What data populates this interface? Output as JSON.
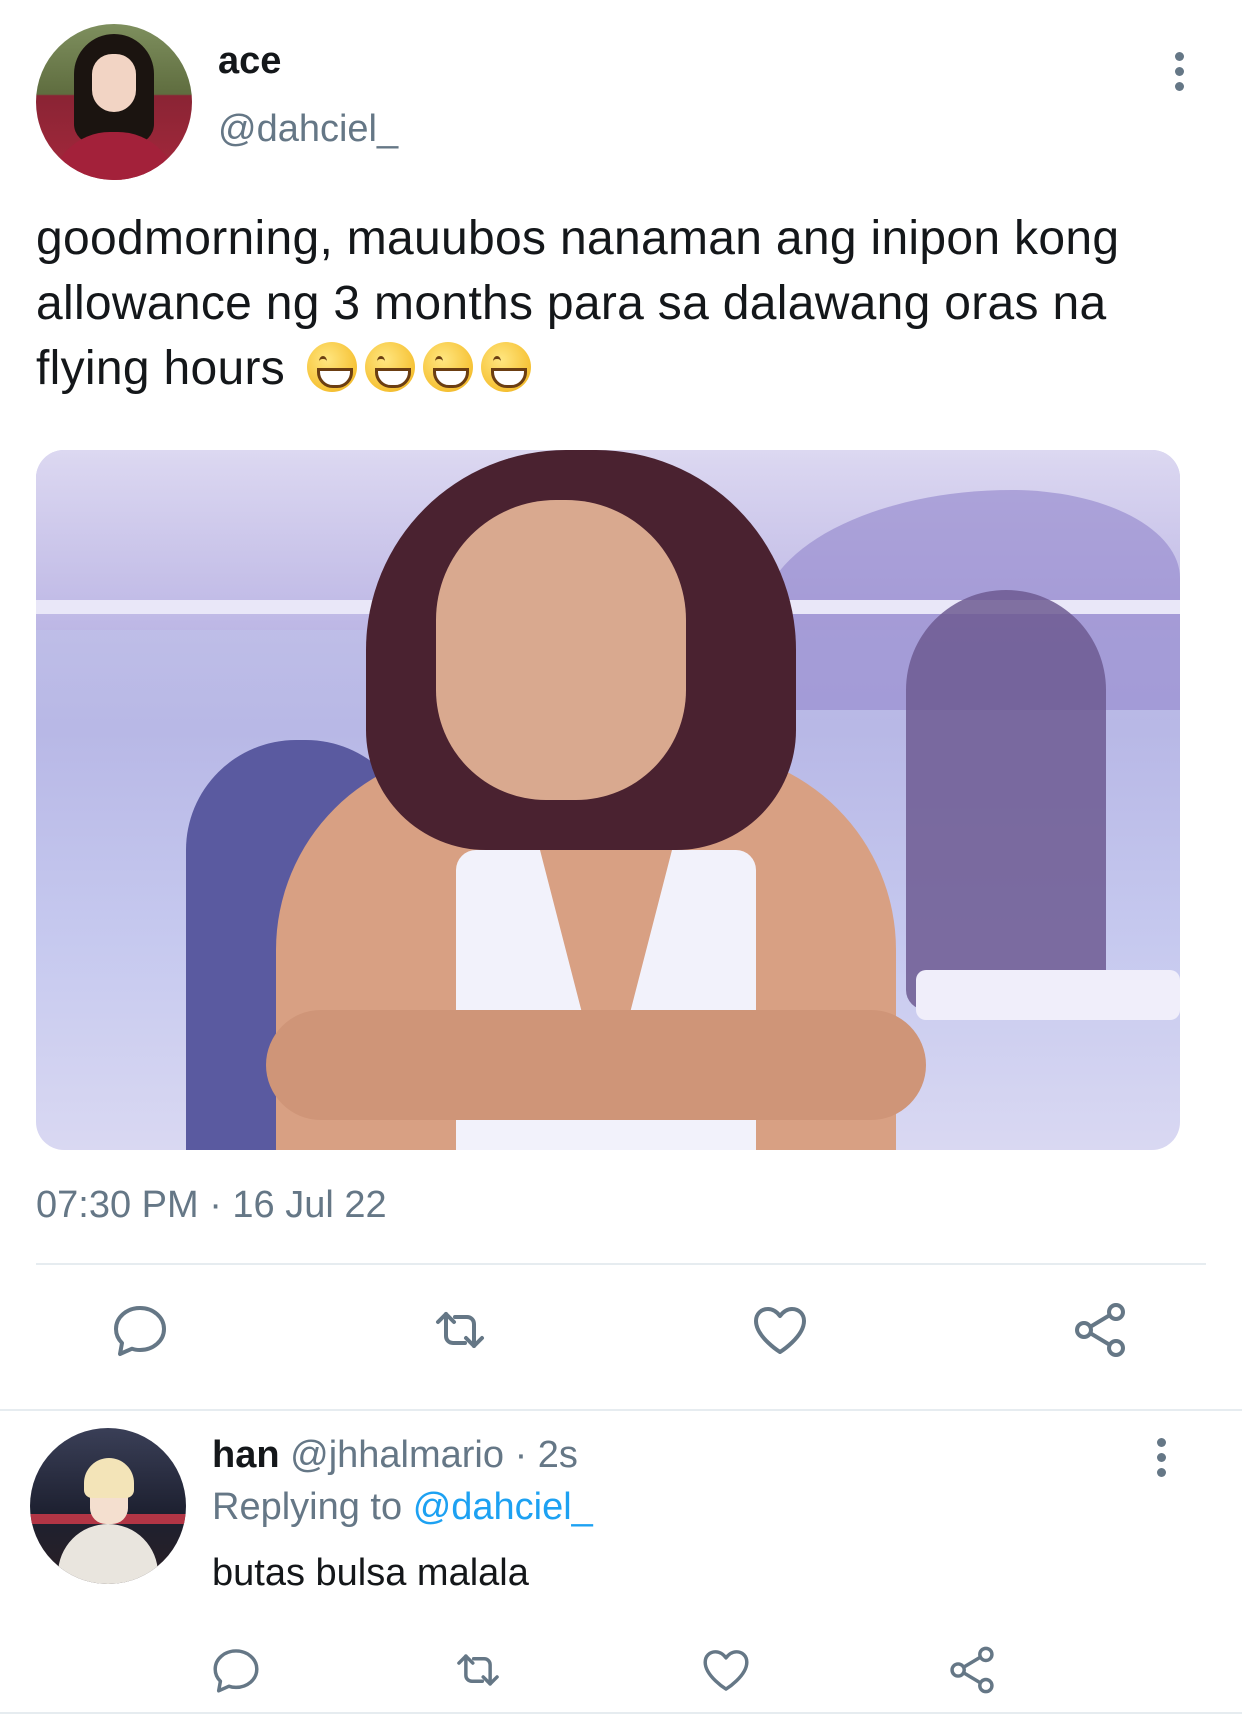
{
  "tweet": {
    "display_name": "ace",
    "handle": "@dahciel_",
    "text": "goodmorning, mauubos nanaman ang inipon kong allowance ng 3 months para sa dalawang oras na flying hours",
    "emoji_count": 4,
    "timestamp": "07:30 PM · 16 Jul 22",
    "actions": [
      "reply-icon",
      "retweet-icon",
      "like-icon",
      "share-icon"
    ]
  },
  "reply": {
    "display_name": "han",
    "meta": "@jhhalmario · 2s",
    "replying_prefix": "Replying to",
    "replying_to": "@dahciel_",
    "text": "butas bulsa malala"
  },
  "colors": {
    "primary_text": "#14171a",
    "secondary_text": "#657786",
    "accent": "#1da1f2",
    "divider": "#e6ecf0"
  }
}
